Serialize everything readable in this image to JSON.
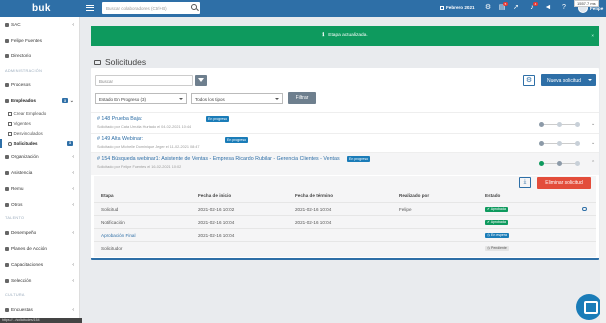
{
  "app": {
    "logo": "buk"
  },
  "topbar": {
    "search_placeholder": "Buscar colaboradores (Ctrl+B)",
    "date": "Febrero 2021",
    "notif_badge_1": "5",
    "notif_badge_2": "4",
    "user_name": "Felipe",
    "tooltip": "1557.7 ms"
  },
  "sidebar": {
    "items": [
      {
        "label": "SAC"
      },
      {
        "label": "Felipe Fuentes"
      },
      {
        "label": "Directorio"
      }
    ],
    "section_admin": "ADMINISTRACIÓN",
    "procesos": "Procesos",
    "empleados": "Empleados",
    "empleados_count": "3",
    "subitems": [
      "Crear Empleado",
      "Vigentes",
      "Desvinculados"
    ],
    "solicitudes": "Solicitudes",
    "solicitudes_count": "3",
    "organizacion": "Organización",
    "asistencia": "Asistencia",
    "remu": "Remu",
    "otros": "Otros",
    "section_talento": "TALENTO",
    "desempeno": "Desempeño",
    "planes": "Planes de Acción",
    "capacitaciones": "Capacitaciones",
    "seleccion": "Selección",
    "section_cultura": "CULTURA",
    "encuestas": "Encuestas",
    "bottom_url": "https://.../solicitudes/154"
  },
  "flash": {
    "message": "Etapa actualizada.",
    "close": "×"
  },
  "page": {
    "title": "Solicitudes"
  },
  "filters": {
    "search_placeholder": "Buscar",
    "estado": "Estado En Progreso (3)",
    "tipos": "Todos los tipos",
    "filter_button": "Filtrar",
    "new_button": "Nueva solicitud"
  },
  "solicitudes": [
    {
      "title": "# 148 Prueba Baja:",
      "tag": "En progreso",
      "sub": "Solicitado por Cata Urrutia Hurtado el 04-02-2021 10:44"
    },
    {
      "title": "# 149 Alta Webinar:",
      "tag": "En progreso",
      "sub": "Solicitado por Michelle Dominique Jeger el 11-02-2021 08:47"
    },
    {
      "title": "# 154 Búsqueda webinar1: Asistente de Ventas - Empresa Ricardo Rubilar - Gerencia Clientes - Ventas",
      "tag": "En progreso",
      "sub": "Solicitado por Felipe Fuentes el 16-02-2021 10:02"
    }
  ],
  "detail": {
    "delete_button": "Eliminar solicitud",
    "headers": [
      "Etapa",
      "Fecha de inicio",
      "Fecha de término",
      "Realizado por",
      "Estado"
    ],
    "rows": [
      {
        "etapa": "Solicitud",
        "inicio": "2021-02-16 10:02",
        "termino": "2021-02-16 10:04",
        "por": "Felipe",
        "estado": "Aprobada"
      },
      {
        "etapa": "Notificación",
        "inicio": "2021-02-16 10:04",
        "termino": "2021-02-16 10:04",
        "por": "",
        "estado": "Aprobada"
      },
      {
        "etapa": "Aprobación Final",
        "inicio": "2021-02-16 10:04",
        "termino": "",
        "por": "",
        "estado": "En espera"
      },
      {
        "etapa": "Solicitudor",
        "inicio": "",
        "termino": "",
        "por": "",
        "estado": "Pendiente"
      }
    ]
  },
  "colors": {
    "primary": "#2e6fa7",
    "success": "#0e9a5e",
    "danger": "#e34d3b",
    "info": "#1a7cb8"
  }
}
